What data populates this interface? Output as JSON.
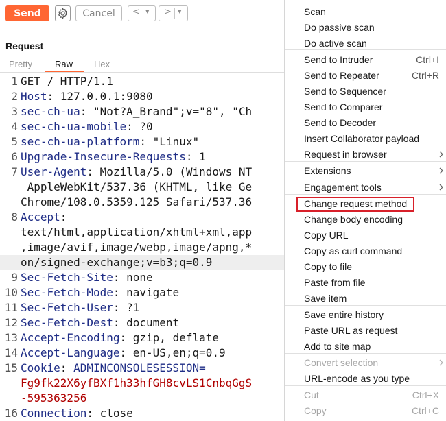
{
  "toolbar": {
    "send_label": "Send",
    "cancel_label": "Cancel",
    "back_label": "<",
    "forward_label": ">",
    "dropdown_label": "▾",
    "send_color": "#ff6633",
    "gear_icon": "gear-icon"
  },
  "request": {
    "title": "Request",
    "tabs": [
      "Pretty",
      "Raw",
      "Hex"
    ],
    "active_tab": "Raw",
    "lines": [
      {
        "num": "1",
        "key": "GET / HTTP/1.1",
        "sep": "",
        "val": ""
      },
      {
        "num": "2",
        "key": "Host",
        "sep": ": ",
        "val": "127.0.0.1:9080"
      },
      {
        "num": "3",
        "key": "sec-ch-ua",
        "sep": ": ",
        "val": "\"Not?A_Brand\";v=\"8\", \"Ch"
      },
      {
        "num": "4",
        "key": "sec-ch-ua-mobile",
        "sep": ": ",
        "val": "?0"
      },
      {
        "num": "5",
        "key": "sec-ch-ua-platform",
        "sep": ": ",
        "val": "\"Linux\""
      },
      {
        "num": "6",
        "key": "Upgrade-Insecure-Requests",
        "sep": ": ",
        "val": "1"
      },
      {
        "num": "7",
        "key": "User-Agent",
        "sep": ": ",
        "val": "Mozilla/5.0 (Windows NT"
      },
      {
        "num": "",
        "key": "",
        "sep": "",
        "val": " AppleWebKit/537.36 (KHTML, like Ge"
      },
      {
        "num": "",
        "key": "",
        "sep": "",
        "val": "Chrome/108.0.5359.125 Safari/537.36"
      },
      {
        "num": "8",
        "key": "Accept",
        "sep": ":",
        "val": ""
      },
      {
        "num": "",
        "key": "",
        "sep": "",
        "val": "text/html,application/xhtml+xml,app"
      },
      {
        "num": "",
        "key": "",
        "sep": "",
        "val": ",image/avif,image/webp,image/apng,*"
      },
      {
        "num": "",
        "key": "",
        "sep": "",
        "val": "on/signed-exchange;v=b3;q=0.9",
        "highlight": true
      },
      {
        "num": "9",
        "key": "Sec-Fetch-Site",
        "sep": ": ",
        "val": "none"
      },
      {
        "num": "10",
        "key": "Sec-Fetch-Mode",
        "sep": ": ",
        "val": "navigate"
      },
      {
        "num": "11",
        "key": "Sec-Fetch-User",
        "sep": ": ",
        "val": "?1"
      },
      {
        "num": "12",
        "key": "Sec-Fetch-Dest",
        "sep": ": ",
        "val": "document"
      },
      {
        "num": "13",
        "key": "Accept-Encoding",
        "sep": ": ",
        "val": "gzip, deflate"
      },
      {
        "num": "14",
        "key": "Accept-Language",
        "sep": ": ",
        "val": "en-US,en;q=0.9"
      },
      {
        "num": "15",
        "key": "Cookie",
        "sep": ": ",
        "val": "ADMINCONSOLESESSION=",
        "val_style": "key"
      },
      {
        "num": "",
        "key": "",
        "sep": "",
        "val": "Fg9fk22X6yfBXf1h33hfGH8cvLS1CnbqGgS",
        "val_style": "red"
      },
      {
        "num": "",
        "key": "",
        "sep": "",
        "val": "-595363256",
        "val_style": "red"
      },
      {
        "num": "16",
        "key": "Connection",
        "sep": ": ",
        "val": "close"
      }
    ]
  },
  "context_menu": {
    "highlight_color": "#d8202a",
    "items": [
      {
        "label": "Scan",
        "shortcut": "",
        "submenu": false,
        "disabled": false
      },
      {
        "label": "Do passive scan",
        "shortcut": "",
        "submenu": false,
        "disabled": false
      },
      {
        "label": "Do active scan",
        "shortcut": "",
        "submenu": false,
        "disabled": false
      },
      {
        "separator": true
      },
      {
        "label": "Send to Intruder",
        "shortcut": "Ctrl+I",
        "submenu": false,
        "disabled": false
      },
      {
        "label": "Send to Repeater",
        "shortcut": "Ctrl+R",
        "submenu": false,
        "disabled": false
      },
      {
        "label": "Send to Sequencer",
        "shortcut": "",
        "submenu": false,
        "disabled": false
      },
      {
        "label": "Send to Comparer",
        "shortcut": "",
        "submenu": false,
        "disabled": false
      },
      {
        "label": "Send to Decoder",
        "shortcut": "",
        "submenu": false,
        "disabled": false
      },
      {
        "label": "Insert Collaborator payload",
        "shortcut": "",
        "submenu": false,
        "disabled": false
      },
      {
        "label": "Request in browser",
        "shortcut": "",
        "submenu": true,
        "disabled": false
      },
      {
        "separator": true
      },
      {
        "label": "Extensions",
        "shortcut": "",
        "submenu": true,
        "disabled": false
      },
      {
        "label": "Engagement tools",
        "shortcut": "",
        "submenu": true,
        "disabled": false
      },
      {
        "separator": true
      },
      {
        "label": "Change request method",
        "shortcut": "",
        "submenu": false,
        "disabled": false,
        "boxed": true
      },
      {
        "label": "Change body encoding",
        "shortcut": "",
        "submenu": false,
        "disabled": false
      },
      {
        "label": "Copy URL",
        "shortcut": "",
        "submenu": false,
        "disabled": false
      },
      {
        "label": "Copy as curl command",
        "shortcut": "",
        "submenu": false,
        "disabled": false
      },
      {
        "label": "Copy to file",
        "shortcut": "",
        "submenu": false,
        "disabled": false
      },
      {
        "label": "Paste from file",
        "shortcut": "",
        "submenu": false,
        "disabled": false
      },
      {
        "label": "Save item",
        "shortcut": "",
        "submenu": false,
        "disabled": false
      },
      {
        "separator": true
      },
      {
        "label": "Save entire history",
        "shortcut": "",
        "submenu": false,
        "disabled": false
      },
      {
        "label": "Paste URL as request",
        "shortcut": "",
        "submenu": false,
        "disabled": false
      },
      {
        "label": "Add to site map",
        "shortcut": "",
        "submenu": false,
        "disabled": false
      },
      {
        "separator": true
      },
      {
        "label": "Convert selection",
        "shortcut": "",
        "submenu": true,
        "disabled": true
      },
      {
        "label": "URL-encode as you type",
        "shortcut": "",
        "submenu": false,
        "disabled": false
      },
      {
        "separator": true
      },
      {
        "label": "Cut",
        "shortcut": "Ctrl+X",
        "submenu": false,
        "disabled": true
      },
      {
        "label": "Copy",
        "shortcut": "Ctrl+C",
        "submenu": false,
        "disabled": true
      }
    ]
  }
}
